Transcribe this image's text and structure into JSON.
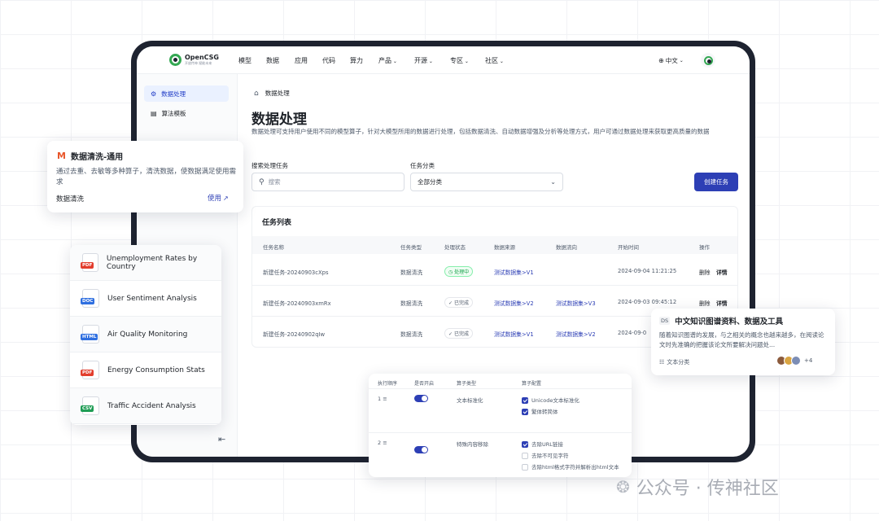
{
  "logo": {
    "name": "OpenCSG",
    "tagline": "开放传神 赋能未来"
  },
  "nav": {
    "items": [
      "模型",
      "数据",
      "应用",
      "代码",
      "算力",
      "产品",
      "开源",
      "专区",
      "社区"
    ],
    "dropdown_flags": [
      false,
      false,
      false,
      false,
      false,
      true,
      true,
      true,
      true
    ],
    "language": "中文"
  },
  "sidebar": {
    "items": [
      {
        "label": "数据处理",
        "active": true
      },
      {
        "label": "算法模板",
        "active": false
      }
    ]
  },
  "breadcrumb": "数据处理",
  "page": {
    "title": "数据处理",
    "description": "数据处理可支持用户使用不同的模型算子，针对大模型所用的数据进行处理，包括数据清洗、自动数据增强及分析等处理方式，用户可通过数据处理来获取更高质量的数据"
  },
  "filters": {
    "search_label": "搜索处理任务",
    "search_placeholder": "搜索",
    "category_label": "任务分类",
    "category_value": "全部分类",
    "create_button": "创建任务"
  },
  "task_list": {
    "title": "任务列表",
    "columns": [
      "任务名称",
      "任务类型",
      "处理状态",
      "数据来源",
      "数据流向",
      "开始时间",
      "操作"
    ],
    "rows": [
      {
        "name": "新建任务-20240903cXps",
        "type": "数据清洗",
        "status": "处理中",
        "status_kind": "processing",
        "source": "测试数据集>V1",
        "target": "",
        "time": "2024-09-04 11:21:25",
        "actions": [
          "删除",
          "详情"
        ]
      },
      {
        "name": "新建任务-20240903xmRx",
        "type": "数据清洗",
        "status": "已完成",
        "status_kind": "done",
        "source": "测试数据集>V2",
        "target": "测试数据集>V3",
        "time": "2024-09-03 09:45:12",
        "actions": [
          "删除",
          "详情"
        ]
      },
      {
        "name": "新建任务-20240902qIw",
        "type": "数据清洗",
        "status": "已完成",
        "status_kind": "done",
        "source": "测试数据集>V1",
        "target": "测试数据集>V2",
        "time": "2024-09-0",
        "actions": []
      }
    ]
  },
  "template_card": {
    "title": "数据清洗-通用",
    "description": "通过去重、去敏等多种算子，清洗数据，使数据满足使用需求",
    "tag": "数据清洗",
    "use_label": "使用"
  },
  "file_list": [
    {
      "type": "PDF",
      "name": "Unemployment Rates by Country",
      "color": "#e23d2d"
    },
    {
      "type": "DOC",
      "name": "User Sentiment Analysis",
      "color": "#2f6fe0"
    },
    {
      "type": "HTML",
      "name": "Air Quality Monitoring",
      "color": "#2f6fe0"
    },
    {
      "type": "PDF",
      "name": "Energy Consumption Stats",
      "color": "#e23d2d"
    },
    {
      "type": "CSV",
      "name": "Traffic Accident Analysis",
      "color": "#1f9d55"
    }
  ],
  "operator_config": {
    "columns": [
      "执行顺序",
      "是否开启",
      "算子类型",
      "算子配置"
    ],
    "rows": [
      {
        "order": "1",
        "type": "文本标准化",
        "options": [
          {
            "label": "Unicode文本标准化",
            "checked": true
          },
          {
            "label": "繁体转简体",
            "checked": true
          }
        ]
      },
      {
        "order": "2",
        "type": "特殊内容移除",
        "options": [
          {
            "label": "去除URL链接",
            "checked": true
          },
          {
            "label": "去除不可见字符",
            "checked": false
          },
          {
            "label": "去除html格式字符并解析出html文本",
            "checked": false
          }
        ]
      }
    ]
  },
  "knowledge_card": {
    "badge": "DS",
    "title": "中文知识图谱资料、数据及工具",
    "description": "随着知识图谱的发展，与之相关的概念也越来越多，在阅读论文时先准确的把握该论文所要解决问题处...",
    "category": "文本分类",
    "more_count": "+4"
  },
  "watermark": "公众号 · 传神社区",
  "colors": {
    "primary": "#2d3fb5",
    "frame": "#1e2330",
    "brand_green": "#34a853"
  }
}
